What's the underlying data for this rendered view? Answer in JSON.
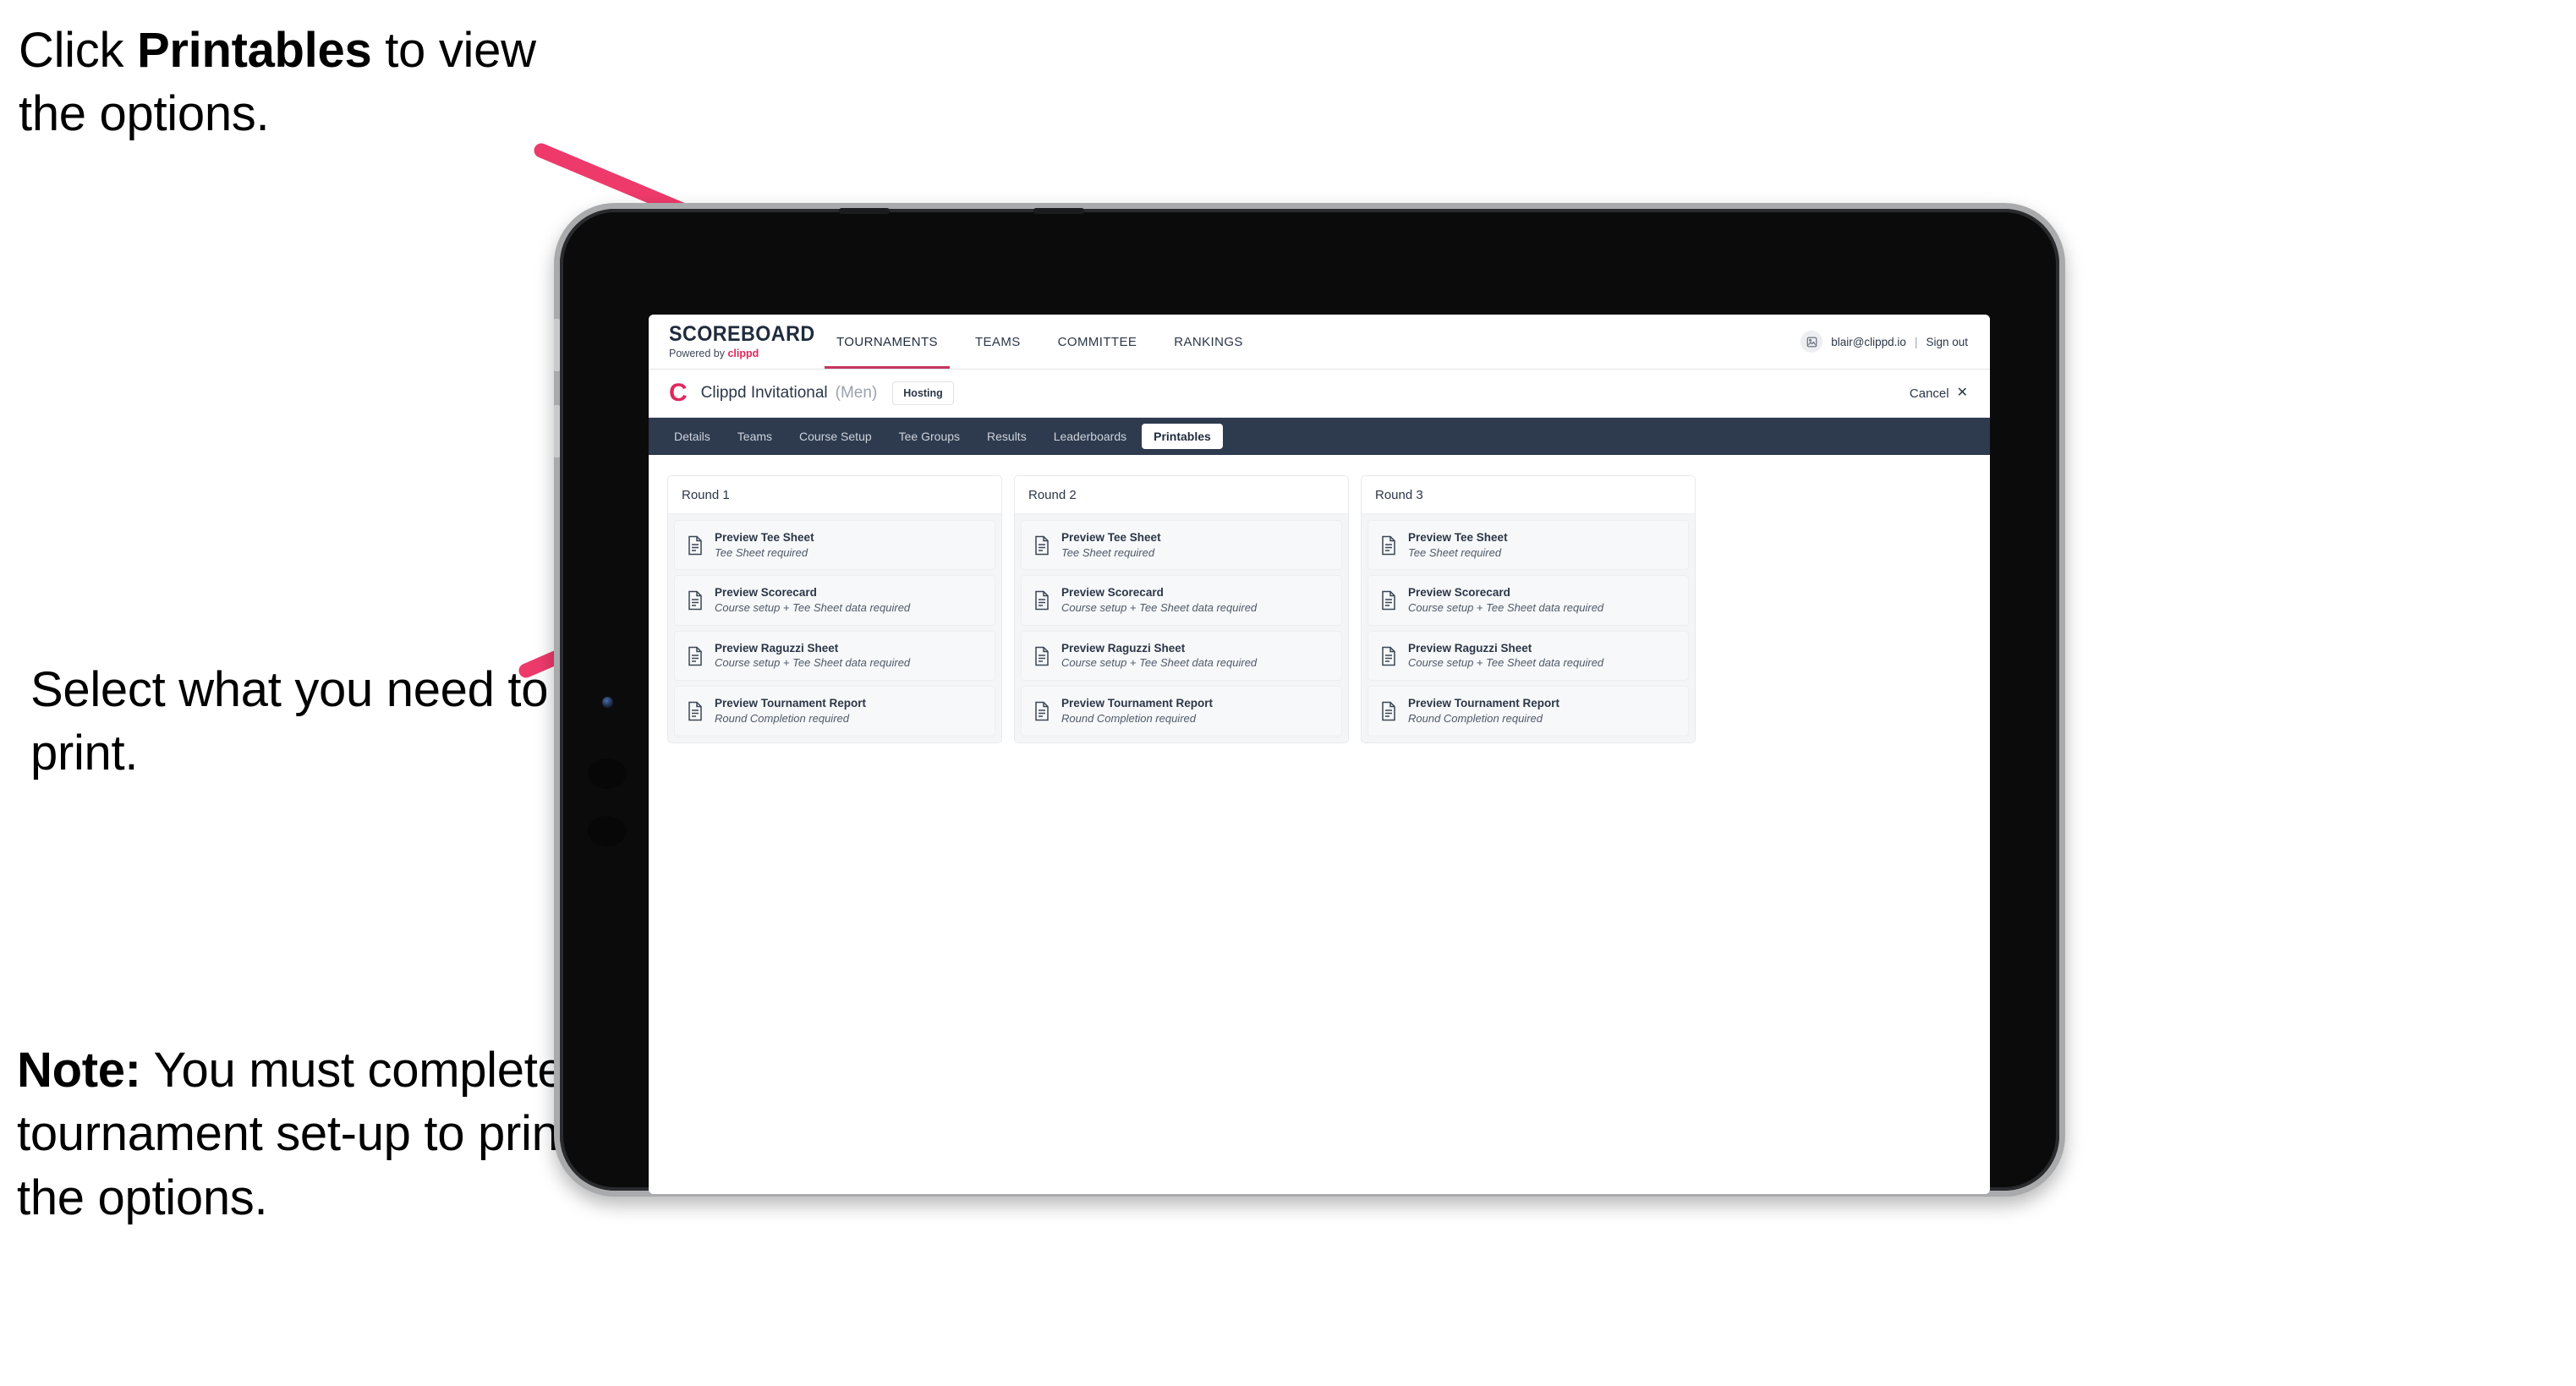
{
  "annotations": {
    "click_printables": {
      "prefix": "Click ",
      "bold": "Printables",
      "suffix": " to view the options."
    },
    "select_print": "Select what you need to print.",
    "note": {
      "bold": "Note:",
      "text": " You must complete the tournament set-up to print all the options."
    }
  },
  "colors": {
    "arrow_pink": "#ED3A6B",
    "brand_pink": "#E0275B",
    "nav_dark": "#2E3A4E",
    "accent_underline": "#C4355E"
  },
  "app": {
    "brand": {
      "wordmark": "SCOREBOARD",
      "powered_prefix": "Powered by ",
      "powered_brand": "clippd"
    },
    "main_nav": [
      {
        "label": "TOURNAMENTS",
        "active": true
      },
      {
        "label": "TEAMS",
        "active": false
      },
      {
        "label": "COMMITTEE",
        "active": false
      },
      {
        "label": "RANKINGS",
        "active": false
      }
    ],
    "account": {
      "avatar_icon": "user-avatar-icon",
      "email": "blair@clippd.io",
      "separator": "|",
      "sign_out": "Sign out"
    },
    "tournament": {
      "logo_mark": "C",
      "name": "Clippd Invitational",
      "gender": "(Men)",
      "status_badge": "Hosting",
      "cancel_label": "Cancel",
      "cancel_icon": "close-icon"
    },
    "sub_tabs": [
      {
        "label": "Details",
        "active": false
      },
      {
        "label": "Teams",
        "active": false
      },
      {
        "label": "Course Setup",
        "active": false
      },
      {
        "label": "Tee Groups",
        "active": false
      },
      {
        "label": "Results",
        "active": false
      },
      {
        "label": "Leaderboards",
        "active": false
      },
      {
        "label": "Printables",
        "active": true
      }
    ],
    "rounds": [
      {
        "header": "Round 1",
        "cards": [
          {
            "icon": "document-icon",
            "title": "Preview Tee Sheet",
            "subtitle": "Tee Sheet required"
          },
          {
            "icon": "document-icon",
            "title": "Preview Scorecard",
            "subtitle": "Course setup + Tee Sheet data required"
          },
          {
            "icon": "document-icon",
            "title": "Preview Raguzzi Sheet",
            "subtitle": "Course setup + Tee Sheet data required"
          },
          {
            "icon": "document-icon",
            "title": "Preview Tournament Report",
            "subtitle": "Round Completion required"
          }
        ]
      },
      {
        "header": "Round 2",
        "cards": [
          {
            "icon": "document-icon",
            "title": "Preview Tee Sheet",
            "subtitle": "Tee Sheet required"
          },
          {
            "icon": "document-icon",
            "title": "Preview Scorecard",
            "subtitle": "Course setup + Tee Sheet data required"
          },
          {
            "icon": "document-icon",
            "title": "Preview Raguzzi Sheet",
            "subtitle": "Course setup + Tee Sheet data required"
          },
          {
            "icon": "document-icon",
            "title": "Preview Tournament Report",
            "subtitle": "Round Completion required"
          }
        ]
      },
      {
        "header": "Round 3",
        "cards": [
          {
            "icon": "document-icon",
            "title": "Preview Tee Sheet",
            "subtitle": "Tee Sheet required"
          },
          {
            "icon": "document-icon",
            "title": "Preview Scorecard",
            "subtitle": "Course setup + Tee Sheet data required"
          },
          {
            "icon": "document-icon",
            "title": "Preview Raguzzi Sheet",
            "subtitle": "Course setup + Tee Sheet data required"
          },
          {
            "icon": "document-icon",
            "title": "Preview Tournament Report",
            "subtitle": "Round Completion required"
          }
        ]
      }
    ]
  }
}
